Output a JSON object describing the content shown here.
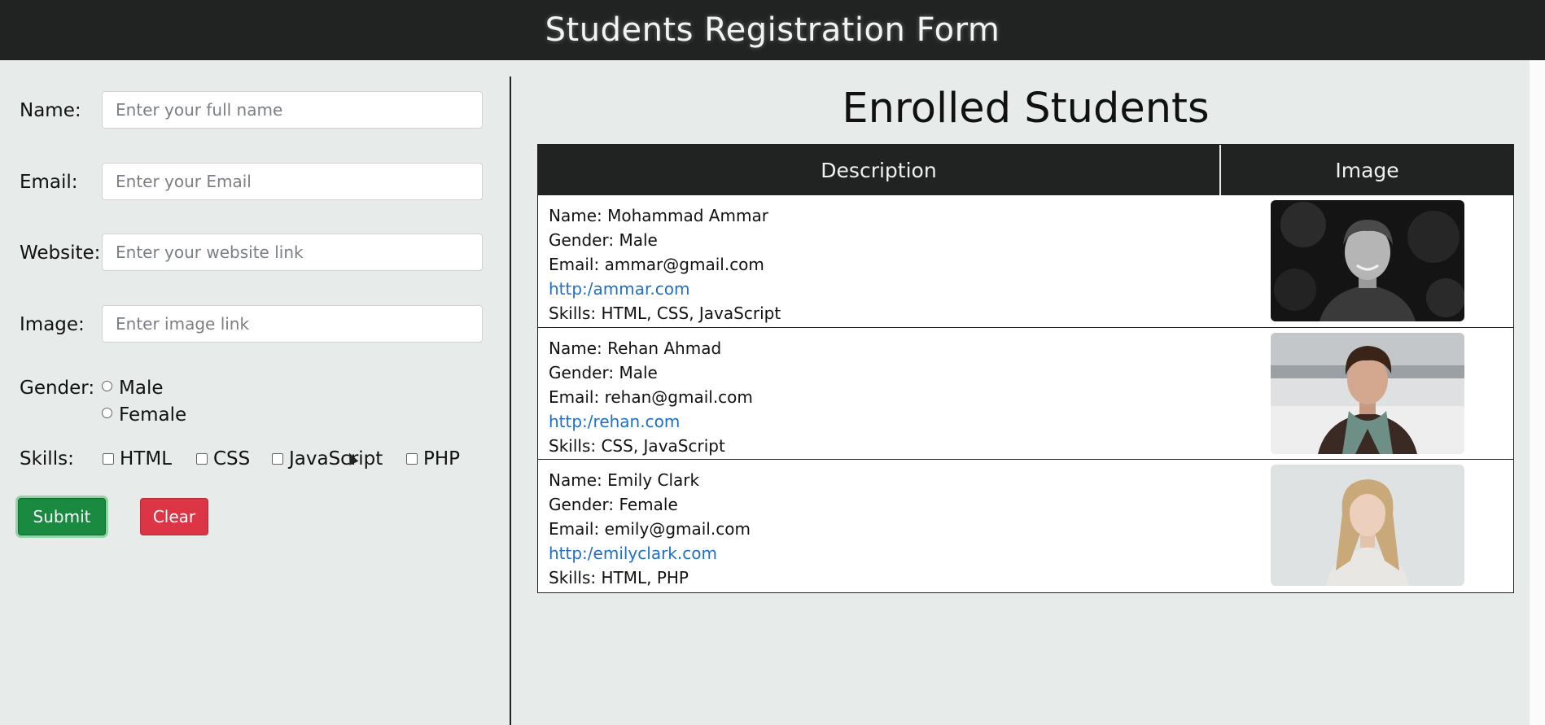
{
  "header": {
    "title": "Students Registration Form"
  },
  "form": {
    "name": {
      "label": "Name:",
      "placeholder": "Enter your full name"
    },
    "email": {
      "label": "Email:",
      "placeholder": "Enter your Email"
    },
    "website": {
      "label": "Website:",
      "placeholder": "Enter your website link"
    },
    "image": {
      "label": "Image:",
      "placeholder": "Enter image link"
    },
    "gender": {
      "label": "Gender:",
      "options": [
        "Male",
        "Female"
      ]
    },
    "skills": {
      "label": "Skills:",
      "options": [
        "HTML",
        "CSS",
        "JavaScript",
        "PHP"
      ]
    },
    "submit_label": "Submit",
    "clear_label": "Clear"
  },
  "panel": {
    "title": "Enrolled Students",
    "columns": [
      "Description",
      "Image"
    ],
    "students": [
      {
        "name": "Name: Mohammad Ammar",
        "gender": "Gender: Male",
        "email": "Email: ammar@gmail.com",
        "website": "http:/ammar.com",
        "skills": "Skills: HTML, CSS, JavaScript",
        "photo": "dark-portrait"
      },
      {
        "name": "Name: Rehan Ahmad",
        "gender": "Gender: Male",
        "email": "Email: rehan@gmail.com",
        "website": "http:/rehan.com",
        "skills": "Skills: CSS, JavaScript",
        "photo": "snow-portrait"
      },
      {
        "name": "Name: Emily Clark",
        "gender": "Gender: Female",
        "email": "Email: emily@gmail.com",
        "website": "http:/emilyclark.com",
        "skills": "Skills: HTML, PHP",
        "photo": "light-portrait"
      }
    ]
  },
  "colors": {
    "header_bg": "#202322",
    "submit": "#198a3f",
    "clear": "#dc3545",
    "link": "#1f6fc4"
  }
}
